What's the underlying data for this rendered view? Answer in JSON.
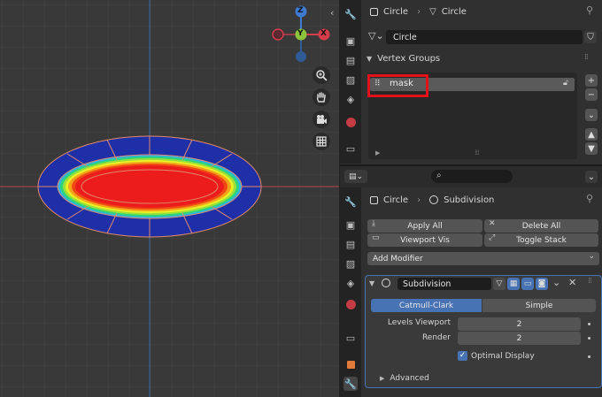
{
  "header": {
    "object_name": "Circle",
    "mesh_name": "Circle",
    "datablock_name": "Circle"
  },
  "vertex_groups": {
    "panel_title": "Vertex Groups",
    "items": [
      {
        "name": "mask",
        "selected": true
      }
    ]
  },
  "modifiers_header": {
    "object_name": "Circle",
    "modifier_name": "Subdivision",
    "search_placeholder": ""
  },
  "actions": {
    "apply_all": "Apply All",
    "delete_all": "Delete All",
    "viewport_vis": "Viewport Vis",
    "toggle_stack": "Toggle Stack",
    "add_modifier": "Add Modifier"
  },
  "modifier": {
    "name": "Subdivision",
    "mode_catmull": "Catmull-Clark",
    "mode_simple": "Simple",
    "active_mode": "Catmull-Clark",
    "levels_viewport_label": "Levels Viewport",
    "levels_viewport_value": "2",
    "render_label": "Render",
    "render_value": "2",
    "optimal_display_label": "Optimal Display",
    "optimal_display_checked": true,
    "advanced_label": "Advanced"
  },
  "gizmo": {
    "z_label": "Z",
    "y_label": "Y",
    "x_label": "X"
  },
  "colors": {
    "highlight_box": "#e3111a",
    "accent_blue": "#4772b3",
    "x_axis": "#d53d4b",
    "y_axis": "#8cc53c",
    "z_axis": "#3d7bd0"
  }
}
